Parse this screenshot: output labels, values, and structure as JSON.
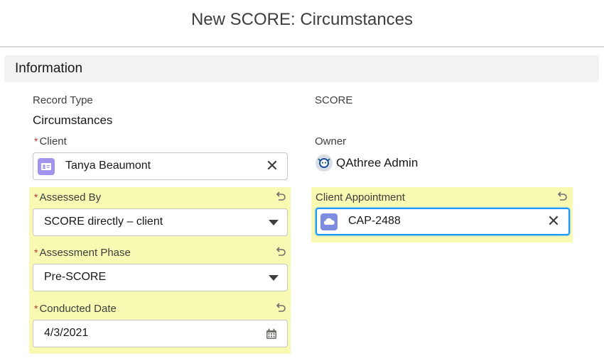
{
  "modal": {
    "title": "New SCORE: Circumstances"
  },
  "section": {
    "title": "Information"
  },
  "left": {
    "record_type_label": "Record Type",
    "record_type_value": "Circumstances",
    "client_label": "Client",
    "client_value": "Tanya Beaumont",
    "assessed_by_label": "Assessed By",
    "assessed_by_value": "SCORE directly – client",
    "assessment_phase_label": "Assessment Phase",
    "assessment_phase_value": "Pre-SCORE",
    "conducted_date_label": "Conducted Date",
    "conducted_date_value": "4/3/2021"
  },
  "right": {
    "score_label": "SCORE",
    "owner_label": "Owner",
    "owner_value": "QAthree Admin",
    "client_appt_label": "Client Appointment",
    "client_appt_value": "CAP-2488"
  },
  "required_marker": "*",
  "clear_glyph": "✕",
  "icons": {
    "contact": "contact-card-icon",
    "appointment": "appointment-cloud-icon",
    "owner": "user-avatar-icon",
    "undo": "undo-icon",
    "calendar": "calendar-icon",
    "dropdown": "chevron-down-icon",
    "clear": "close-icon"
  },
  "colors": {
    "highlight": "#f8fab4",
    "required": "#c23934",
    "focus": "#1b96ff",
    "contact_icon": "#a094ed",
    "appointment_icon": "#7f8de1"
  }
}
